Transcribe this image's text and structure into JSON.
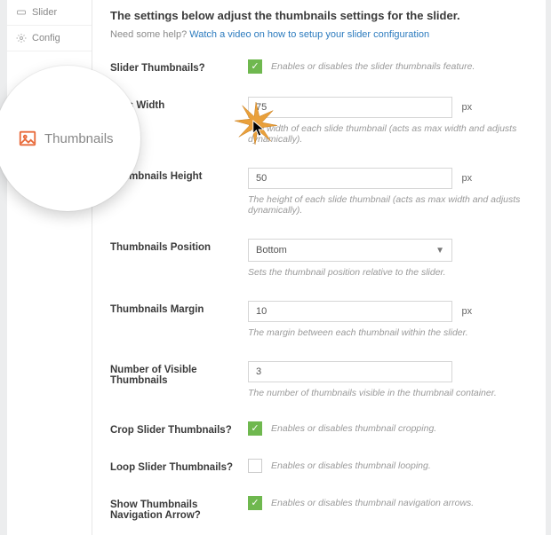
{
  "sidebar": {
    "items": [
      {
        "label": "Slider"
      },
      {
        "label": "Config"
      }
    ]
  },
  "lens_label": "Thumbnails",
  "title": "The settings below adjust the thumbnails settings for the slider.",
  "help_prefix": "Need some help? ",
  "help_link": "Watch a video on how to setup your slider configuration",
  "fields": {
    "slider_thumbnails": {
      "label": "Slider Thumbnails?",
      "desc": "Enables or disables the slider thumbnails feature."
    },
    "width": {
      "label": "nails Width",
      "value": "75",
      "unit": "px",
      "hint": "The width of each slide thumbnail (acts as max width and adjusts dynamically)."
    },
    "height": {
      "label": "Thumbnails Height",
      "value": "50",
      "unit": "px",
      "hint": "The height of each slide thumbnail (acts as max width and adjusts dynamically)."
    },
    "position": {
      "label": "Thumbnails Position",
      "value": "Bottom",
      "hint": "Sets the thumbnail position relative to the slider."
    },
    "margin": {
      "label": "Thumbnails Margin",
      "value": "10",
      "unit": "px",
      "hint": "The margin between each thumbnail within the slider."
    },
    "visible": {
      "label": "Number of Visible Thumbnails",
      "value": "3",
      "hint": "The number of thumbnails visible in the thumbnail container."
    },
    "crop": {
      "label": "Crop Slider Thumbnails?",
      "desc": "Enables or disables thumbnail cropping."
    },
    "loop": {
      "label": "Loop Slider Thumbnails?",
      "desc": "Enables or disables thumbnail looping."
    },
    "nav": {
      "label": "Show Thumbnails Navigation Arrow?",
      "desc": "Enables or disables thumbnail navigation arrows."
    }
  }
}
